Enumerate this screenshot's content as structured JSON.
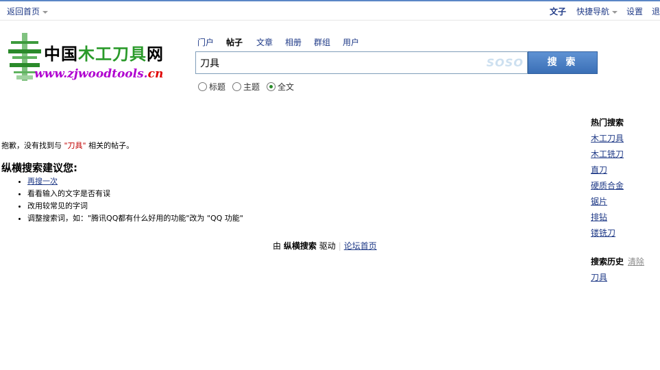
{
  "topbar": {
    "home_label": "返回首页",
    "mode_label": "文子",
    "quicknav_label": "快捷导航",
    "settings_label": "设置",
    "logout_label": "退"
  },
  "logo": {
    "cn_prefix": "中国",
    "cn_green": "木工刀具",
    "cn_suffix": "网",
    "url_prefix": "www.zjwoodtools.",
    "url_suffix": "cn"
  },
  "tabs": [
    "门户",
    "帖子",
    "文章",
    "相册",
    "群组",
    "用户"
  ],
  "active_tab": 1,
  "search": {
    "query": "刀具",
    "brand": "SOSO",
    "button_label": "搜 索"
  },
  "scope_options": [
    {
      "label": "标题",
      "checked": false
    },
    {
      "label": "主题",
      "checked": false
    },
    {
      "label": "全文",
      "checked": true
    }
  ],
  "result": {
    "sorry_prefix": "抱歉，没有找到与",
    "keyword": "\"刀具\"",
    "sorry_suffix": "相关的帖子。"
  },
  "suggest": {
    "title": "纵横搜索建议您:",
    "items": [
      {
        "text": "再搜一次",
        "link": true
      },
      {
        "text": "看看输入的文字是否有误",
        "link": false
      },
      {
        "text": "改用较常见的字词",
        "link": false
      },
      {
        "text": "调整搜索词，如：\"腾讯QQ都有什么好用的功能\"改为 \"QQ 功能\"",
        "link": false
      }
    ]
  },
  "footer": {
    "by": "由",
    "brand": "纵横搜索",
    "driven": "驱动",
    "forum_home": "论坛首页"
  },
  "sidebar": {
    "hot_title": "热门搜索",
    "hot_items": [
      "木工刀具",
      "木工铣刀",
      "直刀",
      "硬质合金",
      "锯片",
      "排钻",
      "镂铣刀"
    ],
    "history_title": "搜索历史",
    "clear_label": "清除",
    "history_items": [
      "刀具"
    ]
  },
  "colors": {
    "link": "#1f3a87",
    "keyword": "#c00000",
    "button": "#3a6fb6"
  }
}
